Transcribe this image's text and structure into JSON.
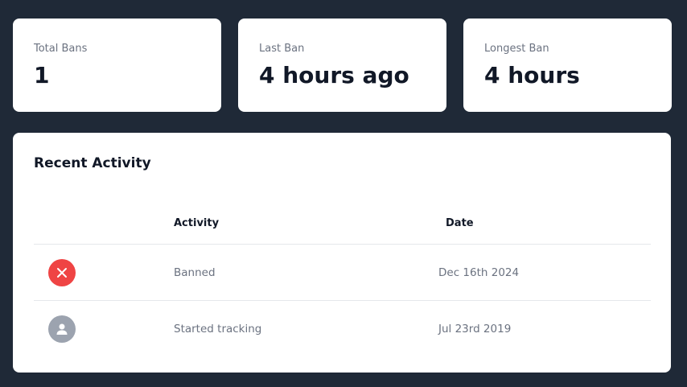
{
  "stats": [
    {
      "label": "Total Bans",
      "value": "1"
    },
    {
      "label": "Last Ban",
      "value": "4 hours ago"
    },
    {
      "label": "Longest Ban",
      "value": "4 hours"
    }
  ],
  "activity": {
    "title": "Recent Activity",
    "columns": {
      "activity": "Activity",
      "date": "Date"
    },
    "rows": [
      {
        "icon": "close-icon",
        "icon_color": "#ef4444",
        "activity": "Banned",
        "date": "Dec 16th 2024"
      },
      {
        "icon": "user-icon",
        "icon_color": "#9ca3af",
        "activity": "Started tracking",
        "date": "Jul 23rd 2019"
      }
    ]
  },
  "colors": {
    "background": "#1f2937",
    "card": "#ffffff",
    "danger": "#ef4444",
    "muted": "#9ca3af"
  }
}
